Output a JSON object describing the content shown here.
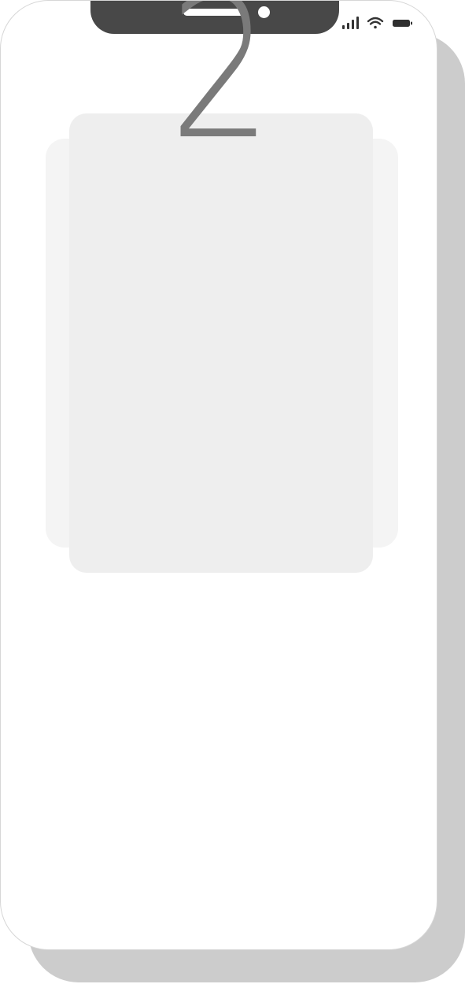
{
  "device": {
    "status_icons": [
      "signal-bars-icon",
      "wifi-icon",
      "battery-icon"
    ]
  },
  "carousel": {
    "current_card_label": "2"
  },
  "colors": {
    "phone_frame": "#ffffff",
    "phone_shadow": "#cccccc",
    "notch": "#484848",
    "card_front": "#eeeeee",
    "card_back": "#f4f4f4",
    "number": "#7a7a7a"
  }
}
